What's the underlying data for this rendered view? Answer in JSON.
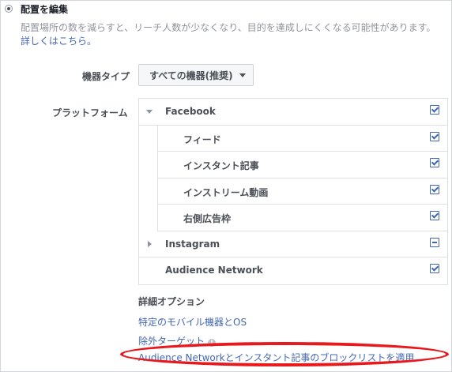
{
  "header": {
    "title": "配置を編集",
    "description": "配置場所の数を減らすと、リーチ人数が少なくなり、目的を達成しにくくなる可能性があります。",
    "learn_more": "詳しくはこちら。"
  },
  "device_type": {
    "label": "機器タイプ",
    "value": "すべての機器(推奨)"
  },
  "platform": {
    "label": "プラットフォーム",
    "items": [
      {
        "label": "Facebook",
        "state": "checked",
        "expanded": true
      },
      {
        "label": "フィード",
        "state": "checked"
      },
      {
        "label": "インスタント記事",
        "state": "checked"
      },
      {
        "label": "インストリーム動画",
        "state": "checked"
      },
      {
        "label": "右側広告枠",
        "state": "checked"
      },
      {
        "label": "Instagram",
        "state": "partial",
        "expanded": false
      },
      {
        "label": "Audience Network",
        "state": "checked"
      }
    ]
  },
  "advanced": {
    "title": "詳細オプション",
    "mobile_devices_link": "特定のモバイル機器とOS",
    "exclude_link": "除外ターゲット",
    "blocklist_link": "Audience Networkとインスタント記事のブロックリストを適用"
  },
  "colors": {
    "link": "#4267b2",
    "highlight_oval": "#e8191d"
  }
}
